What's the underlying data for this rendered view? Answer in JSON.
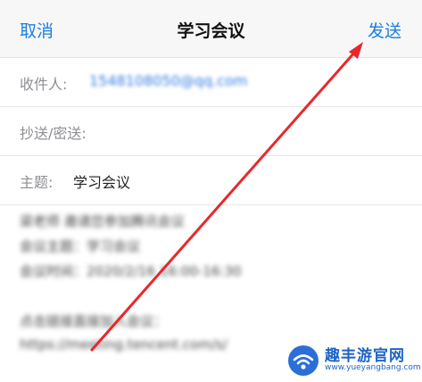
{
  "nav": {
    "cancel_label": "取消",
    "title": "学习会议",
    "send_label": "发送"
  },
  "form": {
    "recipient_label": "收件人:",
    "recipient_value": "1548108050@qq.com",
    "cc_label": "抄送/密送:",
    "subject_label": "主题:",
    "subject_value": "学习会议"
  },
  "message": {
    "line1": "梁老师 邀请您参加腾讯会议",
    "line2": "会议主题：学习会议",
    "line3": "会议时间：2020/2/16 16:00-16:30",
    "line4": "点击链接直接加入会议：",
    "line5": "https://meeting.tencent.com/s/"
  },
  "watermark": {
    "cn": "趣丰游官网",
    "url": "www.yueyangbang.com"
  },
  "colors": {
    "accent_blue": "#1a7fe0",
    "arrow_red": "#e8282b"
  },
  "icons": {
    "watermark_logo": "wifi-logo-icon",
    "annotation": "red-arrow-icon"
  }
}
